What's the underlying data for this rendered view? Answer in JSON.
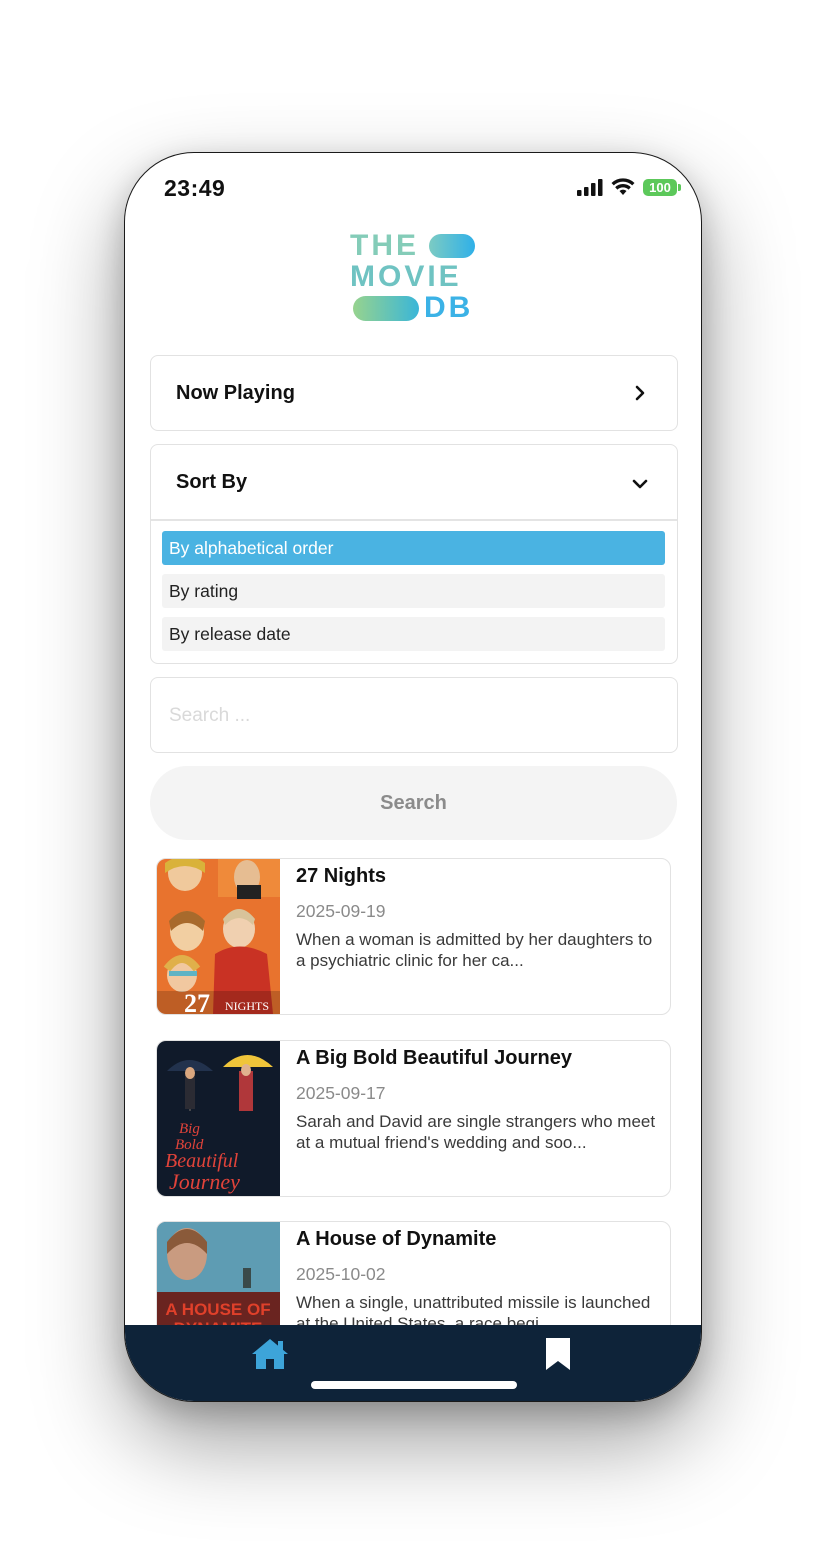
{
  "status_bar": {
    "time": "23:49",
    "battery": "100"
  },
  "logo": {
    "line1": "THE",
    "line2": "MOVIE",
    "line3": "DB"
  },
  "list_selector": {
    "label": "Now Playing"
  },
  "sort": {
    "label": "Sort By",
    "options": [
      {
        "label": "By alphabetical order",
        "selected": true
      },
      {
        "label": "By rating",
        "selected": false
      },
      {
        "label": "By release date",
        "selected": false
      }
    ]
  },
  "search": {
    "placeholder": "Search ...",
    "value": "",
    "button_label": "Search"
  },
  "movies": [
    {
      "title": "27 Nights",
      "release_date": "2025-09-19",
      "overview": "When a woman is admitted by her daughters to a psychiatric clinic for her ca...",
      "poster_text": "27NIGHTS"
    },
    {
      "title": "A Big Bold Beautiful Journey",
      "release_date": "2025-09-17",
      "overview": "Sarah and David are single strangers who meet at a mutual friend's wedding and soo...",
      "poster_text_1": "Big",
      "poster_text_2": "Bold",
      "poster_text_3": "Beautiful",
      "poster_text_4": "Journey"
    },
    {
      "title": "A House of Dynamite",
      "release_date": "2025-10-02",
      "overview": "When a single, unattributed missile is launched at the United States, a race begi...",
      "poster_text_1": "A HOUSE OF",
      "poster_text_2": "DYNAMITE"
    }
  ],
  "tab_bar": {
    "items": [
      {
        "icon": "home-icon",
        "active": true
      },
      {
        "icon": "bookmark-icon",
        "active": false
      }
    ]
  },
  "colors": {
    "accent": "#4ab3e2",
    "tab_bar": "#0e2339",
    "battery": "#5cc85a"
  }
}
